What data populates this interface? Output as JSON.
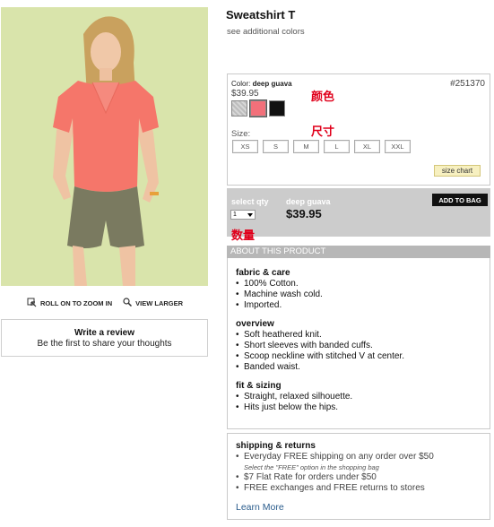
{
  "product": {
    "title": "Sweatshirt T",
    "see_colors": "see additional colors",
    "style_number": "#251370"
  },
  "left": {
    "zoom_label": "ROLL ON TO ZOOM IN",
    "larger_label": "VIEW LARGER",
    "review_title": "Write a review",
    "review_sub": "Be the first to share your thoughts"
  },
  "options": {
    "color_label": "Color:",
    "color_value": "deep guava",
    "price": "$39.95",
    "swatches": [
      {
        "name": "grey",
        "color": "#c8c8c8"
      },
      {
        "name": "deep guava",
        "color": "#f2707a"
      },
      {
        "name": "black",
        "color": "#111111"
      }
    ],
    "size_label": "Size:",
    "sizes": [
      "XS",
      "S",
      "M",
      "L",
      "XL",
      "XXL"
    ],
    "size_chart": "size chart"
  },
  "annotations": {
    "color": "颜色",
    "size": "尺寸",
    "quantity": "数量",
    "color_hex": "#e0001b"
  },
  "buy": {
    "qty_label": "select qty",
    "qty_value": "1",
    "color": "deep guava",
    "price": "$39.95",
    "add_to_bag": "ADD TO BAG"
  },
  "about": {
    "header": "ABOUT THIS PRODUCT",
    "sections": [
      {
        "title": "fabric & care",
        "items": [
          "100% Cotton.",
          "Machine wash cold.",
          "Imported."
        ]
      },
      {
        "title": "overview",
        "items": [
          "Soft heathered knit.",
          "Short sleeves with banded cuffs.",
          "Scoop neckline with stitched V at center.",
          "Banded waist."
        ]
      },
      {
        "title": "fit & sizing",
        "items": [
          "Straight, relaxed silhouette.",
          "Hits just below the hips."
        ]
      }
    ]
  },
  "shipping": {
    "title": "shipping & returns",
    "line1": "Everyday FREE shipping on any order over $50",
    "note": "Select the \"FREE\" option in the shopping bag",
    "line2": "$7 Flat Rate for orders under $50",
    "line3": "FREE exchanges and FREE returns to stores",
    "learn_more": "Learn More"
  }
}
